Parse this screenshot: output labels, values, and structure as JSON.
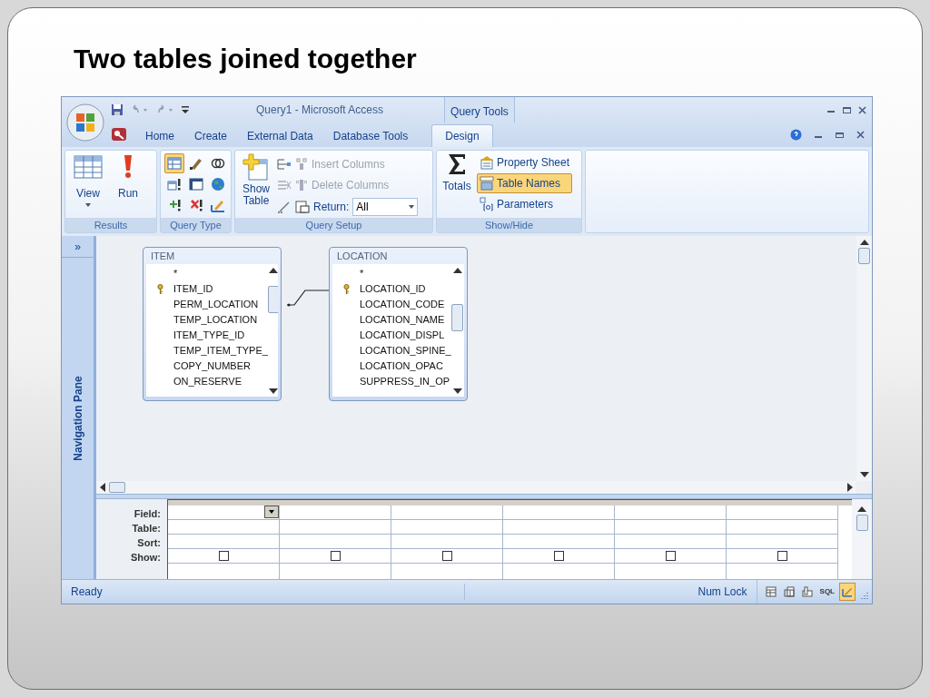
{
  "slide": {
    "title": "Two tables joined together"
  },
  "window": {
    "title": "Query1 - Microsoft Access",
    "context_label": "Query Tools"
  },
  "tabs": [
    {
      "label": "Home",
      "selected": false
    },
    {
      "label": "Create",
      "selected": false
    },
    {
      "label": "External Data",
      "selected": false
    },
    {
      "label": "Database Tools",
      "selected": false
    },
    {
      "label": "Design",
      "selected": true
    }
  ],
  "ribbon": {
    "results": {
      "label": "Results",
      "buttons": [
        {
          "label": "View",
          "kind": "view"
        },
        {
          "label": "Run",
          "kind": "run"
        }
      ]
    },
    "query_type": {
      "label": "Query Type",
      "buttons": [
        {
          "kind": "select",
          "selected": true
        },
        {
          "kind": "update",
          "selected": false
        },
        {
          "kind": "union",
          "selected": false
        },
        {
          "kind": "append",
          "selected": false
        },
        {
          "kind": "crosstab",
          "selected": false
        },
        {
          "kind": "pass_through",
          "selected": false
        },
        {
          "kind": "make_table",
          "selected": false
        },
        {
          "kind": "delete",
          "selected": false
        },
        {
          "kind": "data_definition",
          "selected": false
        }
      ]
    },
    "query_setup": {
      "label": "Query Setup",
      "show_table": "Show Table",
      "buttons": [
        {
          "label": "Insert Columns",
          "disabled": true
        },
        {
          "label": "Delete Columns",
          "disabled": true
        }
      ],
      "return_label": "Return:",
      "return_value": "All"
    },
    "show_hide": {
      "label": "Show/Hide",
      "totals": "Totals",
      "buttons": [
        {
          "label": "Property Sheet",
          "on": false
        },
        {
          "label": "Table Names",
          "on": true
        },
        {
          "label": "Parameters",
          "on": false
        }
      ]
    }
  },
  "nav_pane": {
    "toggle": "»",
    "label": "Navigation Pane"
  },
  "tables": [
    {
      "name": "ITEM",
      "fields": [
        {
          "label": "*",
          "key": false
        },
        {
          "label": "ITEM_ID",
          "key": true
        },
        {
          "label": "PERM_LOCATION",
          "key": false
        },
        {
          "label": "TEMP_LOCATION",
          "key": false
        },
        {
          "label": "ITEM_TYPE_ID",
          "key": false
        },
        {
          "label": "TEMP_ITEM_TYPE_",
          "key": false
        },
        {
          "label": "COPY_NUMBER",
          "key": false
        },
        {
          "label": "ON_RESERVE",
          "key": false
        }
      ]
    },
    {
      "name": "LOCATION",
      "fields": [
        {
          "label": "*",
          "key": false
        },
        {
          "label": "LOCATION_ID",
          "key": true
        },
        {
          "label": "LOCATION_CODE",
          "key": false
        },
        {
          "label": "LOCATION_NAME",
          "key": false
        },
        {
          "label": "LOCATION_DISPL",
          "key": false
        },
        {
          "label": "LOCATION_SPINE_",
          "key": false
        },
        {
          "label": "LOCATION_OPAC",
          "key": false
        },
        {
          "label": "SUPPRESS_IN_OP",
          "key": false
        }
      ]
    }
  ],
  "grid": {
    "row_labels": [
      "Field:",
      "Table:",
      "Sort:",
      "Show:"
    ],
    "columns": [
      {
        "show": false
      },
      {
        "show": false
      },
      {
        "show": false
      },
      {
        "show": false
      },
      {
        "show": false
      },
      {
        "show": false
      }
    ]
  },
  "status_bar": {
    "text": "Ready",
    "indicator": "Num Lock",
    "views": [
      {
        "kind": "datasheet",
        "selected": false
      },
      {
        "kind": "pivot_table",
        "selected": false
      },
      {
        "kind": "pivot_chart",
        "selected": false
      },
      {
        "kind": "sql",
        "label": "SQL",
        "selected": false
      },
      {
        "kind": "design",
        "selected": true
      }
    ]
  }
}
